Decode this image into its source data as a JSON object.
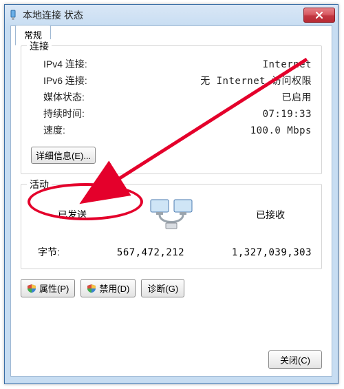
{
  "window": {
    "title": "本地连接 状态"
  },
  "tab": {
    "label": "常规"
  },
  "connection": {
    "group_title": "连接",
    "rows": {
      "ipv4": {
        "label": "IPv4 连接:",
        "value": "Internet"
      },
      "ipv6": {
        "label": "IPv6 连接:",
        "value": "无 Internet 访问权限"
      },
      "media": {
        "label": "媒体状态:",
        "value": "已启用"
      },
      "duration": {
        "label": "持续时间:",
        "value": "07:19:33"
      },
      "speed": {
        "label": "速度:",
        "value": "100.0 Mbps"
      }
    },
    "details_label": "详细信息(E)..."
  },
  "activity": {
    "group_title": "活动",
    "sent_label": "已发送",
    "recv_label": "已接收",
    "bytes_label": "字节:",
    "sent_value": "567,472,212",
    "recv_value": "1,327,039,303"
  },
  "buttons": {
    "properties": "属性(P)",
    "disable": "禁用(D)",
    "diagnose": "诊断(G)",
    "close": "关闭(C)"
  }
}
